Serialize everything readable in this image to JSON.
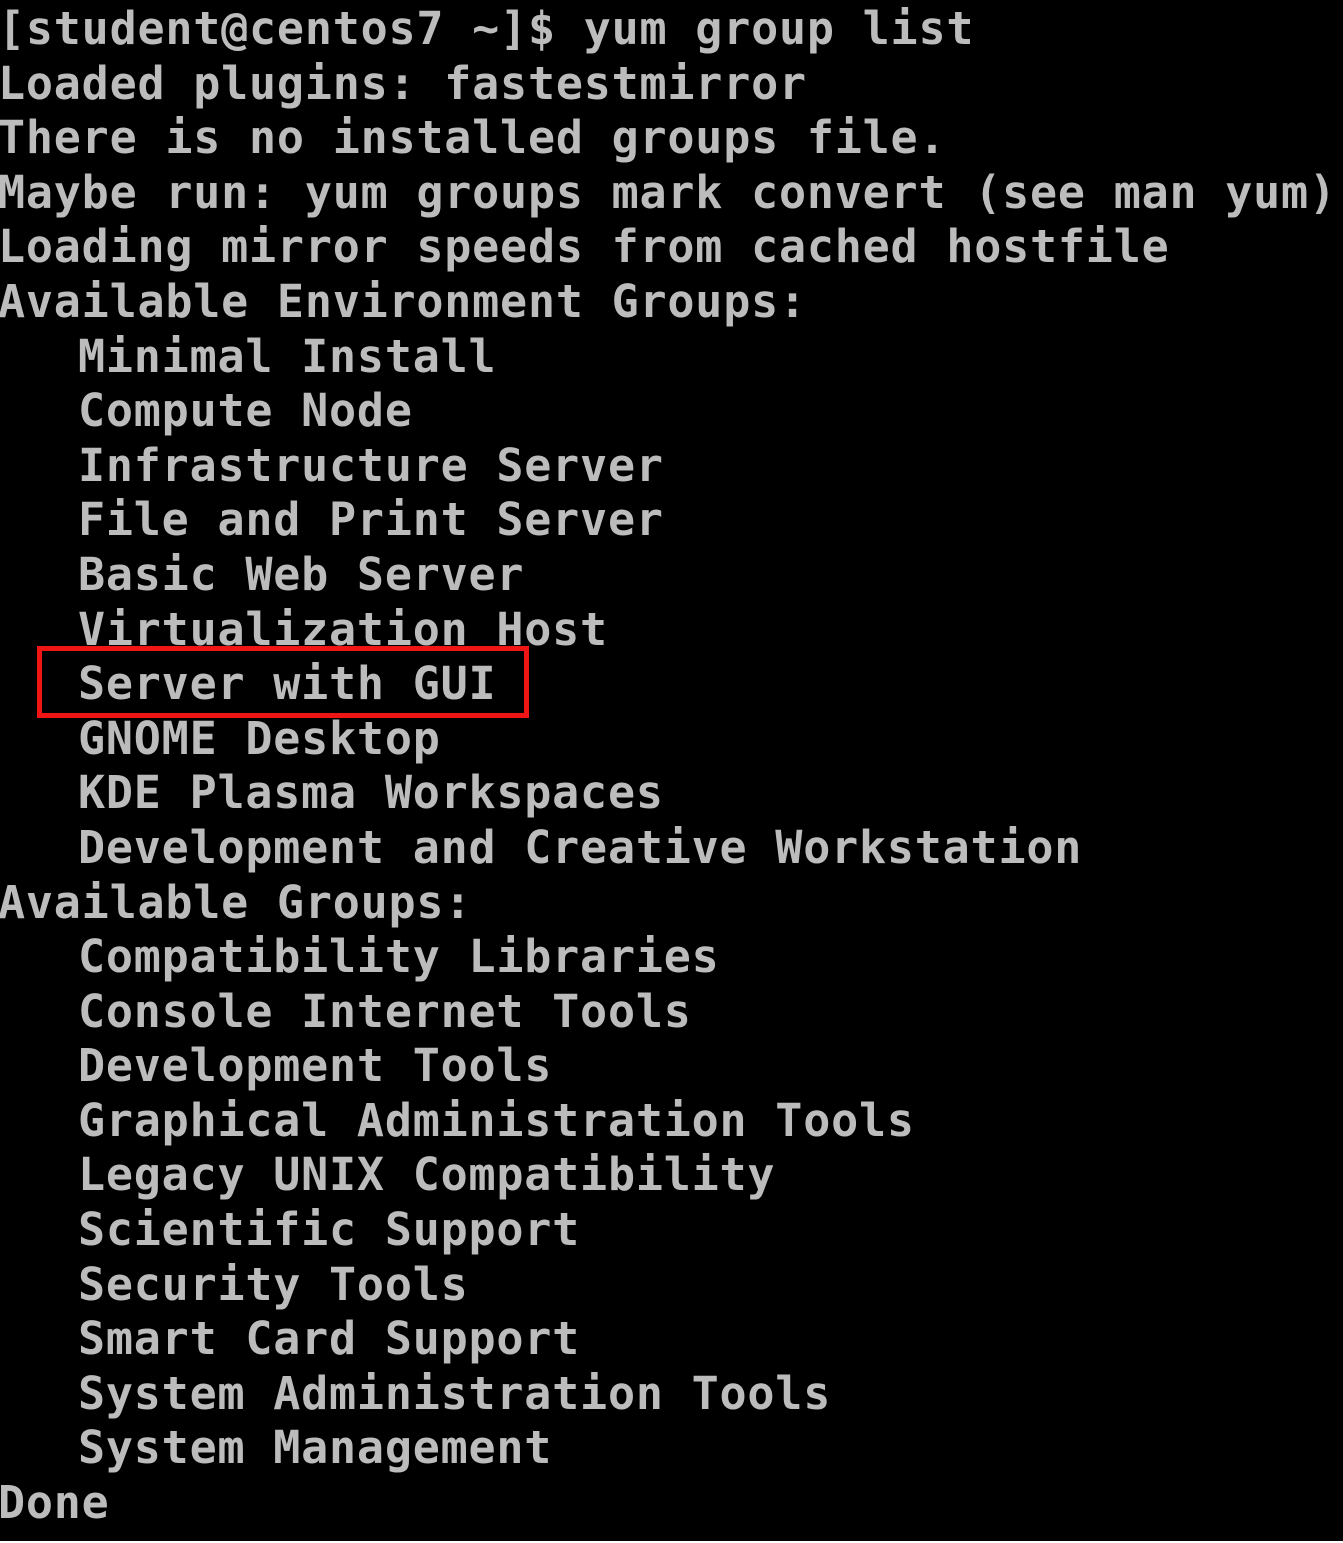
{
  "terminal": {
    "prompt_line": "[student@centos7 ~]$ yum group list",
    "output_lines": [
      "Loaded plugins: fastestmirror",
      "There is no installed groups file.",
      "Maybe run: yum groups mark convert (see man yum)",
      "Loading mirror speeds from cached hostfile"
    ],
    "environment_groups_header": "Available Environment Groups:",
    "environment_groups": [
      "Minimal Install",
      "Compute Node",
      "Infrastructure Server",
      "File and Print Server",
      "Basic Web Server",
      "Virtualization Host",
      "Server with GUI",
      "GNOME Desktop",
      "KDE Plasma Workspaces",
      "Development and Creative Workstation"
    ],
    "groups_header": "Available Groups:",
    "groups": [
      "Compatibility Libraries",
      "Console Internet Tools",
      "Development Tools",
      "Graphical Administration Tools",
      "Legacy UNIX Compatibility",
      "Scientific Support",
      "Security Tools",
      "Smart Card Support",
      "System Administration Tools",
      "System Management"
    ],
    "done_line": "Done"
  },
  "colors": {
    "background": "#000000",
    "text": "#bcbcbc",
    "highlight": "#ef1515"
  }
}
